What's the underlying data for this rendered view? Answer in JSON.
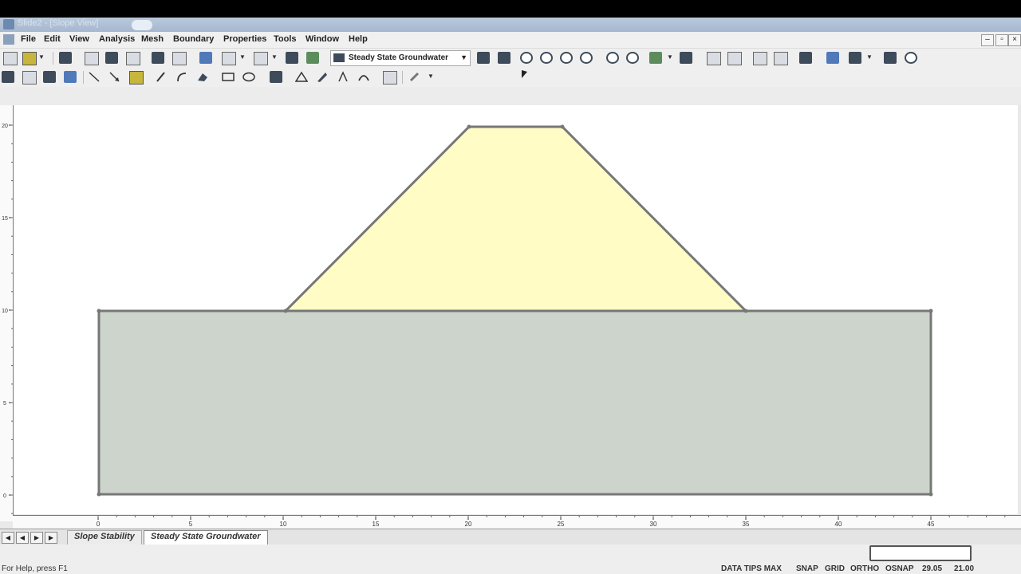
{
  "window": {
    "title": "Slide2 - [Slope View]"
  },
  "menu": {
    "items": [
      "File",
      "Edit",
      "View",
      "Analysis",
      "Mesh",
      "Boundary",
      "Properties",
      "Tools",
      "Window",
      "Help"
    ]
  },
  "toolbar": {
    "analysis_mode": "Steady State Groundwater"
  },
  "ruler": {
    "x_ticks": [
      "0",
      "5",
      "10",
      "15",
      "20",
      "25",
      "30",
      "35",
      "40",
      "45"
    ],
    "y_ticks": [
      "20",
      "15",
      "10",
      "5",
      "0"
    ]
  },
  "tabs": [
    {
      "label": "Slope Stability",
      "active": false
    },
    {
      "label": "Steady State Groundwater",
      "active": true
    }
  ],
  "status": {
    "left": "For Help, press F1",
    "right": [
      "DATA TIPS MAX",
      "SNAP",
      "GRID",
      "ORTHO",
      "OSNAP",
      "29.05",
      "21.00"
    ]
  },
  "colors": {
    "embankment": "#fffcc6",
    "foundation": "#ccd4cc",
    "outline": "#777777"
  }
}
